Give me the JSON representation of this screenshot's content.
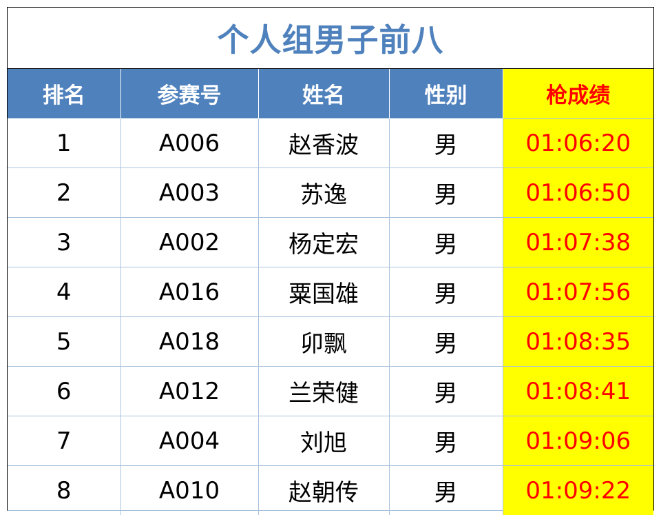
{
  "title": "个人组男子前八",
  "colors": {
    "title_text": "#4f81bd",
    "header_bg": "#4f81bd",
    "header_text": "#ffffff",
    "highlight_bg": "#ffff00",
    "highlight_text": "#ff0000",
    "grid_line": "#a9c2dc"
  },
  "columns": [
    "排名",
    "参赛号",
    "姓名",
    "性别",
    "枪成绩"
  ],
  "rows": [
    {
      "rank": "1",
      "bib": "A006",
      "name": "赵香波",
      "gender": "男",
      "time": "01:06:20"
    },
    {
      "rank": "2",
      "bib": "A003",
      "name": "苏逸",
      "gender": "男",
      "time": "01:06:50"
    },
    {
      "rank": "3",
      "bib": "A002",
      "name": "杨定宏",
      "gender": "男",
      "time": "01:07:38"
    },
    {
      "rank": "4",
      "bib": "A016",
      "name": "粟国雄",
      "gender": "男",
      "time": "01:07:56"
    },
    {
      "rank": "5",
      "bib": "A018",
      "name": "卯飘",
      "gender": "男",
      "time": "01:08:35"
    },
    {
      "rank": "6",
      "bib": "A012",
      "name": "兰荣健",
      "gender": "男",
      "time": "01:08:41"
    },
    {
      "rank": "7",
      "bib": "A004",
      "name": "刘旭",
      "gender": "男",
      "time": "01:09:06"
    },
    {
      "rank": "8",
      "bib": "A010",
      "name": "赵朝传",
      "gender": "男",
      "time": "01:09:22"
    }
  ]
}
